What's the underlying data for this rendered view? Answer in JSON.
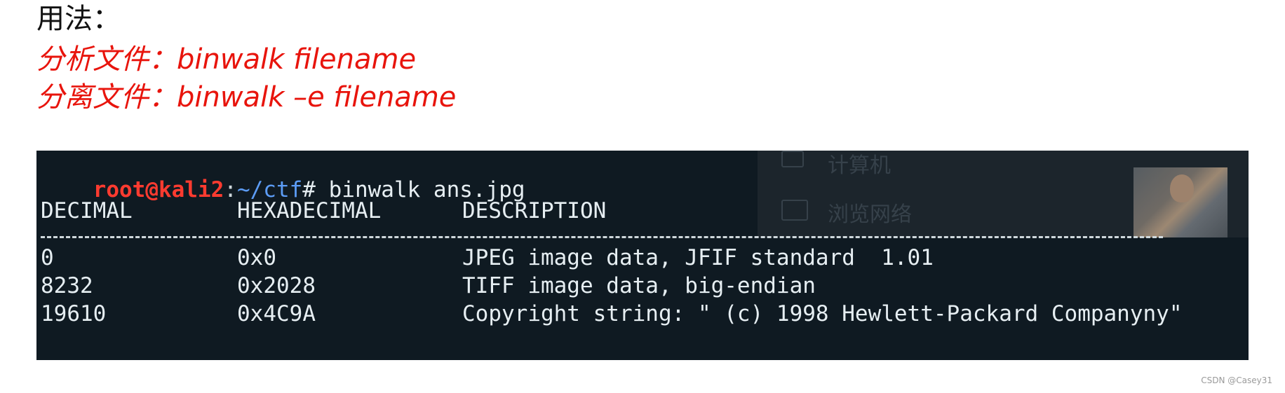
{
  "heading": "用法：",
  "usage": {
    "analyze": "分析文件：binwalk filename",
    "extract": "分离文件：binwalk –e filename"
  },
  "terminal": {
    "prompt": {
      "user": "root@kali2",
      "colon": ":",
      "path": "~/ctf",
      "cmd": "# binwalk ans.jpg"
    },
    "headers": [
      "DECIMAL",
      "HEXADECIMAL",
      "DESCRIPTION"
    ],
    "rows": [
      {
        "decimal": "0",
        "hex": "0x0",
        "description": "JPEG image data, JFIF standard  1.01"
      },
      {
        "decimal": "8232",
        "hex": "0x2028",
        "description": "TIFF image data, big-endian"
      },
      {
        "decimal": "19610",
        "hex": "0x4C9A",
        "description": "Copyright string: \" (c) 1998 Hewlett-Packard Companyny\""
      }
    ],
    "ghost_overlay": {
      "item1": "计算机",
      "item2": "浏览网络"
    }
  },
  "credit": "CSDN @Casey31"
}
